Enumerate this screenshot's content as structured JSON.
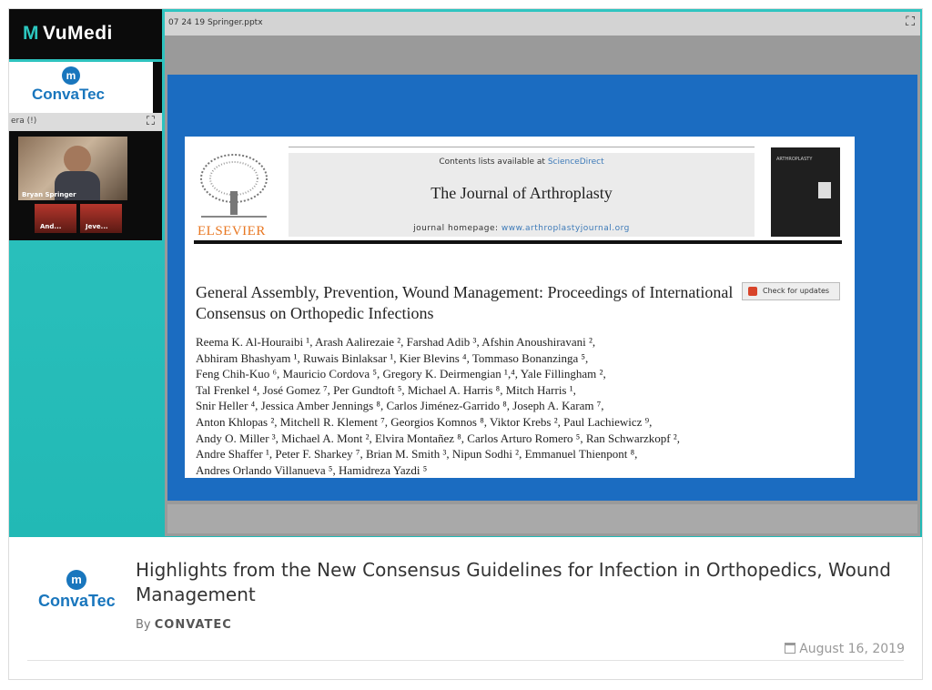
{
  "brand": {
    "name": "VuMedi",
    "logo_text": "VuMedi",
    "accent_color": "#2cc7bf"
  },
  "sponsor": {
    "name": "ConvaTec",
    "icon_glyph": "m",
    "color": "#1976bd"
  },
  "camera": {
    "header_label": "era  (!)",
    "expand_icon": "expand-icon",
    "main_name": "Bryan Springer",
    "thumbs": [
      {
        "name": "And..."
      },
      {
        "name": "Jeve..."
      }
    ]
  },
  "slide": {
    "filename": "07 24 19 Springer.pptx",
    "expand_icon": "expand-icon"
  },
  "paper": {
    "publisher": "ELSEVIER",
    "contents_prefix": "Contents lists available at ",
    "contents_link": "ScienceDirect",
    "journal_title": "The Journal of Arthroplasty",
    "homepage_prefix": "journal homepage: ",
    "homepage_url": "www.arthroplastyjournal.org",
    "cover_title": "ARTHROPLASTY",
    "check_updates": "Check for updates",
    "title": "General Assembly, Prevention, Wound Management: Proceedings of International Consensus on Orthopedic Infections",
    "author_lines": [
      "Reema K. Al-Houraibi ¹, Arash Aalirezaie ², Farshad Adib ³, Afshin Anoushiravani ²,",
      "Abhiram Bhashyam ¹, Ruwais Binlaksar ¹, Kier Blevins ⁴, Tommaso Bonanzinga ⁵,",
      "Feng Chih-Kuo ⁶, Mauricio Cordova ⁵, Gregory K. Deirmengian ¹,⁴, Yale Fillingham ²,",
      "Tal Frenkel ⁴, José Gomez ⁷, Per Gundtoft ⁵, Michael A. Harris ⁸, Mitch Harris ¹,",
      "Snir Heller ⁴, Jessica Amber Jennings ⁸, Carlos Jiménez-Garrido ⁸, Joseph A. Karam ⁷,",
      "Anton Khlopas ², Mitchell R. Klement ⁷, Georgios Komnos ⁸, Viktor Krebs ², Paul Lachiewicz ⁹,",
      "Andy O. Miller ³, Michael A. Mont ², Elvira Montañez ⁸, Carlos Arturo Romero ⁵, Ran Schwarzkopf ²,",
      "Andre Shaffer ¹, Peter F. Sharkey ⁷, Brian M. Smith ³, Nipun Sodhi ², Emmanuel Thienpont ⁸,",
      "Andres Orlando Villanueva ⁵, Hamidreza Yazdi ⁵"
    ]
  },
  "video_info": {
    "title": "Highlights from the New Consensus Guidelines for Infection in Orthopedics, Wound Management",
    "by_prefix": "By ",
    "author": "CONVATEC",
    "date": "August 16, 2019",
    "date_icon": "calendar-icon"
  }
}
